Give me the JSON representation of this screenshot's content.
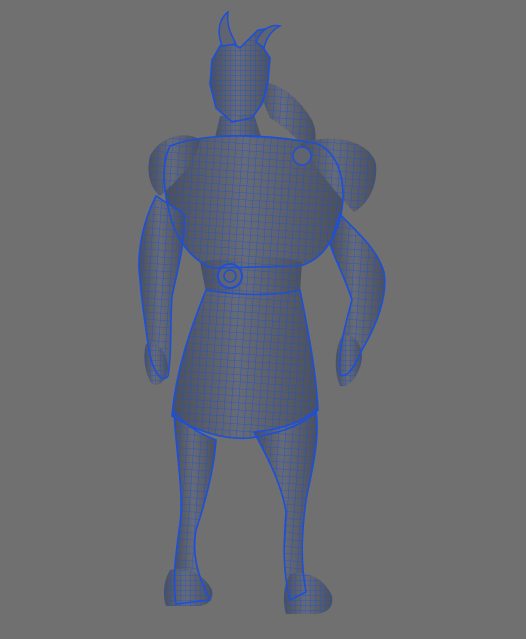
{
  "viewport": {
    "background": "#707070",
    "wire_color": "#1d4fd8",
    "shade_color": "#5f6470",
    "shade_dark": "#4a4f59",
    "model_name": ""
  }
}
